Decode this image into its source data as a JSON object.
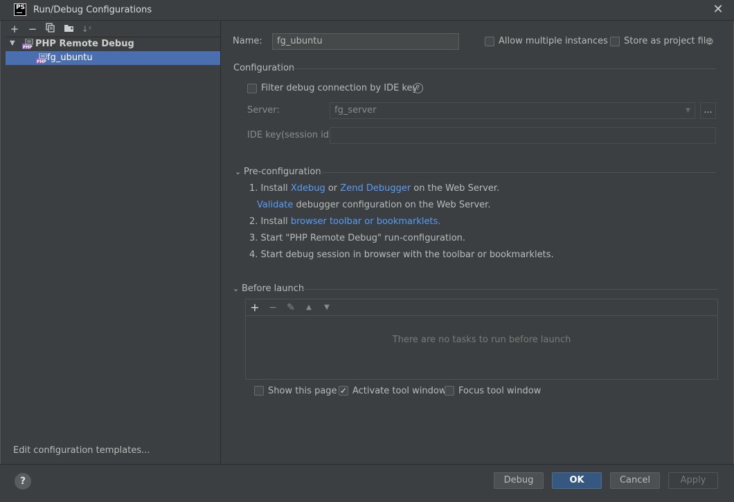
{
  "window": {
    "title": "Run/Debug Configurations",
    "logo_text": "PS"
  },
  "sidebar": {
    "toolbar": [
      "add-icon",
      "remove-icon",
      "copy-icon",
      "folder-icon",
      "sort-icon"
    ],
    "group_label": "PHP Remote Debug",
    "item_label": "fg_ubuntu",
    "templates_link": "Edit configuration templates..."
  },
  "form": {
    "name_label": "Name:",
    "name_value": "fg_ubuntu",
    "allow_multiple_label": "Allow multiple instances",
    "store_project_label": "Store as project file",
    "configuration_header": "Configuration",
    "filter_label": "Filter debug connection by IDE key",
    "server_label": "Server:",
    "server_value": "fg_server",
    "server_browse": "...",
    "idekey_label": "IDE key(session id):",
    "idekey_value": ""
  },
  "preconfig": {
    "header": "Pre-configuration",
    "step1_prefix": "1. Install ",
    "step1_link1": "Xdebug",
    "step1_mid": " or ",
    "step1_link2": "Zend Debugger",
    "step1_suffix": " on the Web Server.",
    "validate_link": "Validate",
    "validate_suffix": " debugger configuration on the Web Server.",
    "step2_prefix": "2. Install ",
    "step2_link": "browser toolbar or bookmarklets.",
    "step3": "3. Start \"PHP Remote Debug\" run-configuration.",
    "step4": "4. Start debug session in browser with the toolbar or bookmarklets."
  },
  "before_launch": {
    "header": "Before launch",
    "empty_text": "There are no tasks to run before launch",
    "show_page_label": "Show this page",
    "activate_tool_label": "Activate tool window",
    "focus_tool_label": "Focus tool window"
  },
  "buttons": {
    "help": "?",
    "debug": "Debug",
    "ok": "OK",
    "cancel": "Cancel",
    "apply": "Apply"
  }
}
